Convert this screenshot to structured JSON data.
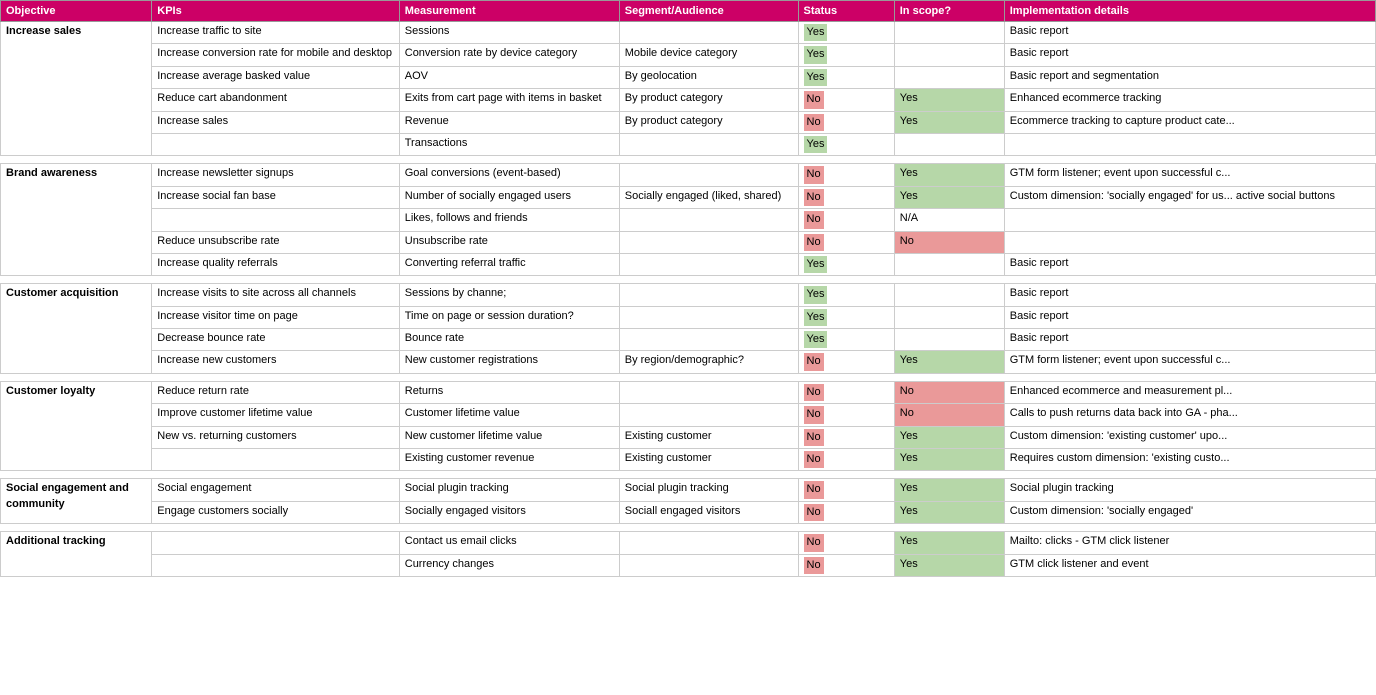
{
  "header": {
    "objective": "Objective",
    "kpis": "KPIs",
    "measurement": "Measurement",
    "segment": "Segment/Audience",
    "status": "Status",
    "inscope": "In scope?",
    "impl": "Implementation details"
  },
  "sections": [
    {
      "objective": "Increase sales",
      "rows": [
        {
          "kpi": "Increase traffic to site",
          "measurement": "Sessions",
          "segment": "",
          "status": "Yes",
          "inscope": "",
          "impl": "Basic report"
        },
        {
          "kpi": "Increase conversion rate for mobile and desktop",
          "measurement": "Conversion rate by device category",
          "segment": "Mobile device category",
          "status": "Yes",
          "inscope": "",
          "impl": "Basic report"
        },
        {
          "kpi": "Increase average basked value",
          "measurement": "AOV",
          "segment": "By geolocation",
          "status": "Yes",
          "inscope": "",
          "impl": "Basic report and segmentation"
        },
        {
          "kpi": "Reduce cart abandonment",
          "measurement": "Exits from cart page with items in basket",
          "segment": "By product category",
          "status": "No",
          "inscope": "Yes",
          "impl": "Enhanced ecommerce tracking"
        },
        {
          "kpi": "Increase sales",
          "measurement": "Revenue",
          "segment": "By product category",
          "status": "No",
          "inscope": "Yes",
          "impl": "Ecommerce tracking to capture product cate..."
        },
        {
          "kpi": "",
          "measurement": "Transactions",
          "segment": "",
          "status": "Yes",
          "inscope": "",
          "impl": ""
        }
      ]
    },
    {
      "objective": "Brand awareness",
      "rows": [
        {
          "kpi": "Increase newsletter signups",
          "measurement": "Goal conversions (event-based)",
          "segment": "",
          "status": "No",
          "inscope": "Yes",
          "impl": "GTM form listener; event upon successful c..."
        },
        {
          "kpi": "Increase social fan base",
          "measurement": "Number of socially engaged users",
          "segment": "Socially engaged (liked, shared)",
          "status": "No",
          "inscope": "Yes",
          "impl": "Custom dimension: 'socially engaged' for us... active social buttons"
        },
        {
          "kpi": "",
          "measurement": "Likes, follows and friends",
          "segment": "",
          "status": "No",
          "inscope": "N/A",
          "impl": ""
        },
        {
          "kpi": "Reduce unsubscribe rate",
          "measurement": "Unsubscribe rate",
          "segment": "",
          "status": "No",
          "inscope": "No",
          "impl": ""
        },
        {
          "kpi": "Increase quality referrals",
          "measurement": "Converting referral traffic",
          "segment": "",
          "status": "Yes",
          "inscope": "",
          "impl": "Basic report"
        }
      ]
    },
    {
      "objective": "Customer acquisition",
      "rows": [
        {
          "kpi": "Increase visits to site across all channels",
          "measurement": "Sessions by channe;",
          "segment": "",
          "status": "Yes",
          "inscope": "",
          "impl": "Basic report"
        },
        {
          "kpi": "Increase visitor time on page",
          "measurement": "Time on page or session duration?",
          "segment": "",
          "status": "Yes",
          "inscope": "",
          "impl": "Basic report"
        },
        {
          "kpi": "Decrease bounce rate",
          "measurement": "Bounce rate",
          "segment": "",
          "status": "Yes",
          "inscope": "",
          "impl": "Basic report"
        },
        {
          "kpi": "Increase new customers",
          "measurement": "New customer registrations",
          "segment": "By region/demographic?",
          "status": "No",
          "inscope": "Yes",
          "impl": "GTM form listener; event upon successful c..."
        }
      ]
    },
    {
      "objective": "Customer loyalty",
      "rows": [
        {
          "kpi": "Reduce return rate",
          "measurement": "Returns",
          "segment": "",
          "status": "No",
          "inscope": "No",
          "impl": "Enhanced ecommerce and measurement pl..."
        },
        {
          "kpi": "Improve customer lifetime value",
          "measurement": "Customer lifetime value",
          "segment": "",
          "status": "No",
          "inscope": "No",
          "impl": "Calls to push returns data back into GA - pha..."
        },
        {
          "kpi": "New vs. returning customers",
          "measurement": "New customer lifetime value",
          "segment": "Existing customer",
          "status": "No",
          "inscope": "Yes",
          "impl": "Custom dimension: 'existing customer' upo..."
        },
        {
          "kpi": "",
          "measurement": "Existing customer revenue",
          "segment": "Existing customer",
          "status": "No",
          "inscope": "Yes",
          "impl": "Requires custom dimension: 'existing custo..."
        }
      ]
    },
    {
      "objective": "Social engagement and community",
      "rows": [
        {
          "kpi": "Social engagement",
          "measurement": "Social plugin tracking",
          "segment": "Social plugin tracking",
          "status": "No",
          "inscope": "Yes",
          "impl": "Social plugin tracking"
        },
        {
          "kpi": "Engage customers socially",
          "measurement": "Socially engaged visitors",
          "segment": "Sociall engaged visitors",
          "status": "No",
          "inscope": "Yes",
          "impl": "Custom dimension: 'socially engaged'"
        }
      ]
    },
    {
      "objective": "Additional tracking",
      "rows": [
        {
          "kpi": "",
          "measurement": "Contact us email clicks",
          "segment": "",
          "status": "No",
          "inscope": "Yes",
          "impl": "Mailto: clicks - GTM click listener"
        },
        {
          "kpi": "",
          "measurement": "Currency changes",
          "segment": "",
          "status": "No",
          "inscope": "Yes",
          "impl": "GTM click listener and event"
        }
      ]
    }
  ]
}
